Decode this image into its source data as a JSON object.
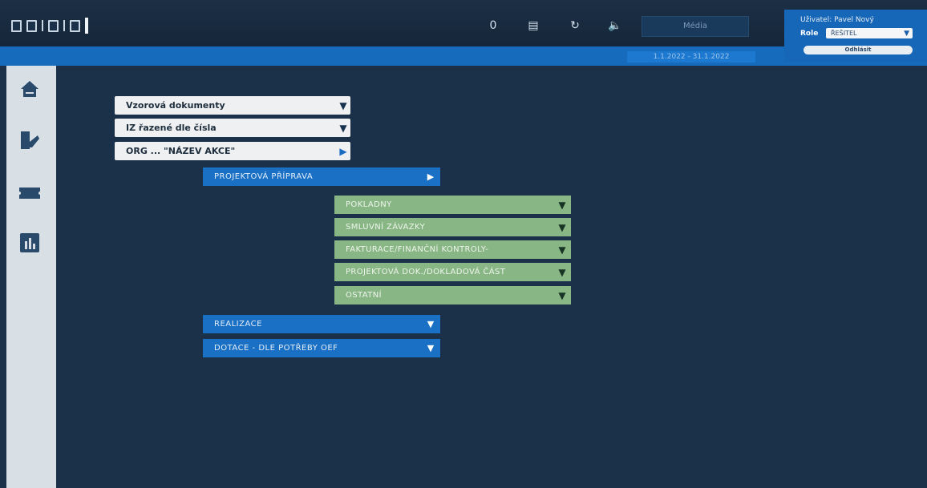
{
  "header": {
    "toolbar_icons": [
      {
        "name": "counter",
        "glyph": "0"
      },
      {
        "name": "list-icon",
        "glyph": "▤"
      },
      {
        "name": "refresh-icon",
        "glyph": "↻"
      },
      {
        "name": "sound-icon",
        "glyph": "🔈"
      }
    ],
    "media_label": "Média",
    "date_range": "1.1.2022 - 31.1.2022"
  },
  "user": {
    "label": "Uživatel: Pavel Nový",
    "role_label": "Role",
    "role_value": "ŘEŠITEL",
    "logout_label": "Odhlásit"
  },
  "sidebar": {
    "icons": [
      "home-icon",
      "documents-icon",
      "ticket-icon",
      "chart-icon"
    ]
  },
  "documents": {
    "select_1": "Vzorová dokumenty",
    "select_2": "IZ řazené dle čísla",
    "select_3": "ORG ... \"NÁZEV AKCE\""
  },
  "menu": {
    "projektova_priprava": "PROJEKTOVÁ PŘÍPRAVA",
    "realizace": "REALIZACE",
    "dotace": "DOTACE - DLE POTŘEBY OEF"
  },
  "submenu": {
    "items": [
      "POKLADNY",
      "SMLUVNÍ ZÁVAZKY",
      "FAKTURACE/FINANČNÍ KONTROLY-",
      "PROJEKTOVÁ DOK./DOKLADOVÁ ČÁST",
      "OSTATNÍ"
    ]
  },
  "colors": {
    "background": "#1b3149",
    "accent_blue": "#1a70c4",
    "green": "#89b685",
    "sidebar": "#d8e0e6"
  }
}
